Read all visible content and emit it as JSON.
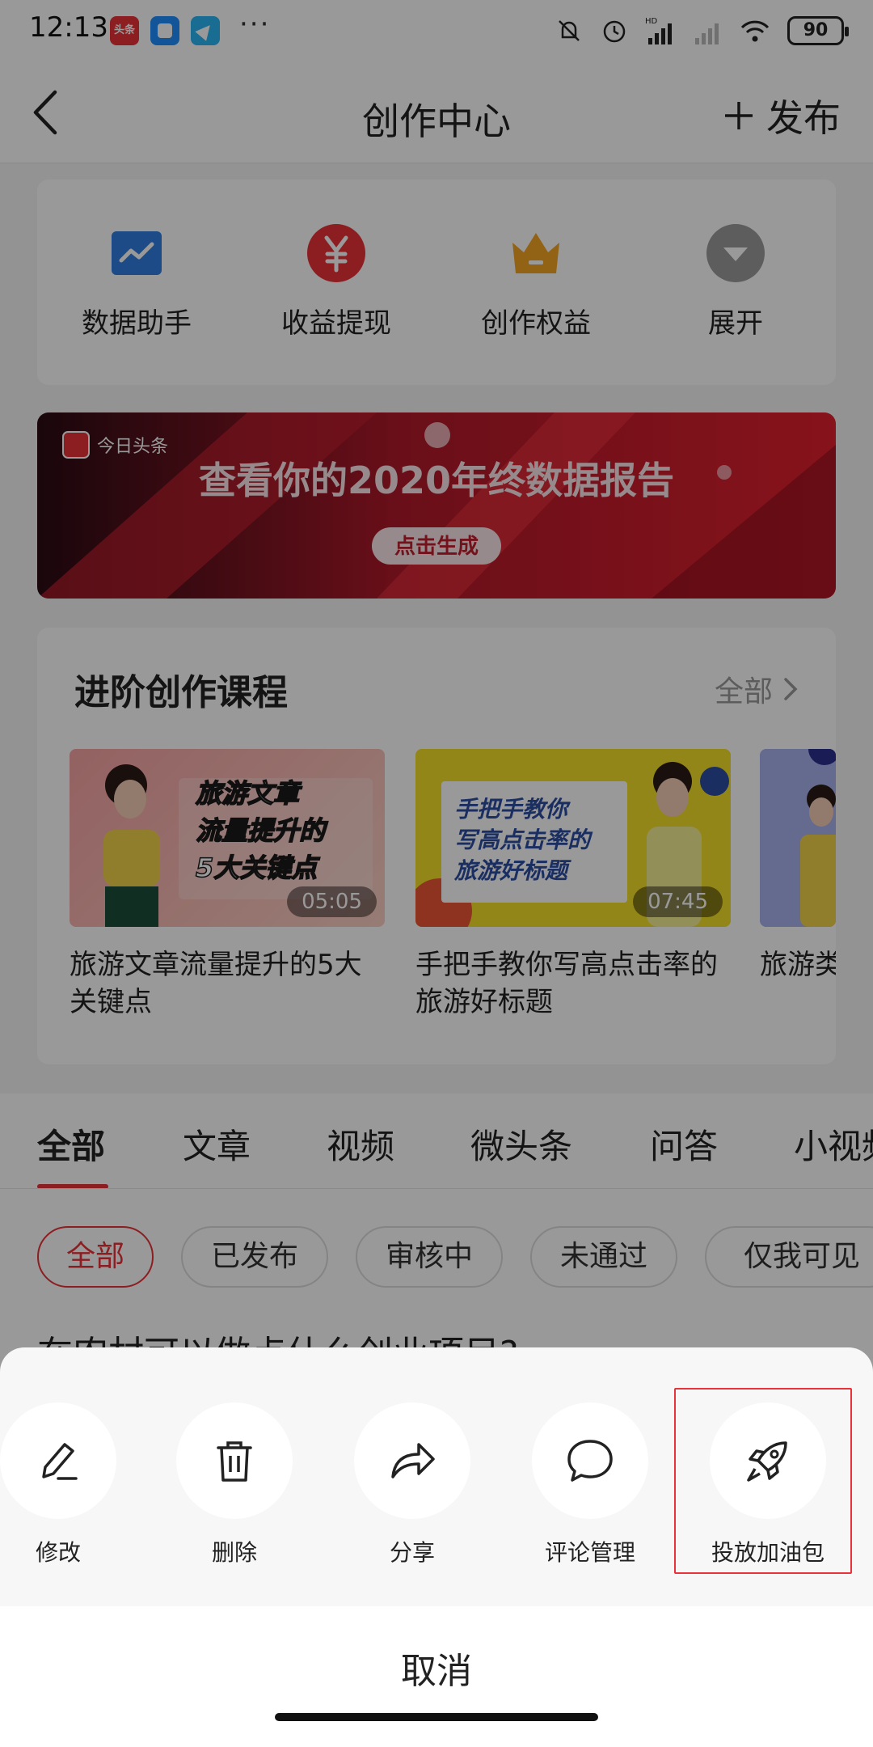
{
  "status_bar": {
    "time": "12:13",
    "badge1": "头条",
    "dots": "···",
    "battery": "90",
    "icons": [
      "mute-icon",
      "alarm-icon",
      "hd-signal-icon",
      "signal-icon",
      "wifi-icon",
      "battery-icon"
    ]
  },
  "header": {
    "title": "创作中心",
    "publish_label": "发布"
  },
  "quick_actions": [
    {
      "label": "数据助手",
      "icon": "chart-icon",
      "color": "#2f7de1"
    },
    {
      "label": "收益提现",
      "icon": "yuan-icon",
      "color": "#e9333a"
    },
    {
      "label": "创作权益",
      "icon": "crown-icon",
      "color": "#f5a623"
    },
    {
      "label": "展开",
      "icon": "expand-icon",
      "color": "#9b9b9b"
    }
  ],
  "banner": {
    "brand": "今日头条",
    "headline": "查看你的2020年终数据报告",
    "cta": "点击生成"
  },
  "courses": {
    "title": "进阶创作课程",
    "all_label": "全部",
    "items": [
      {
        "name": "旅游文章流量提升的5大关键点",
        "duration": "05:05",
        "thumb_text": "旅游文章\n流量提升的\n5大关键点"
      },
      {
        "name": "手把手教你写高点击率的旅游好标题",
        "duration": "07:45",
        "thumb_text": "手把手教你\n写高点击率的\n旅游好标题"
      },
      {
        "name": "旅游类",
        "duration": ""
      }
    ]
  },
  "tabs": [
    "全部",
    "文章",
    "视频",
    "微头条",
    "问答",
    "小视频"
  ],
  "filters": [
    "全部",
    "已发布",
    "审核中",
    "未通过",
    "仅我可见"
  ],
  "article_peek": "在农村可以做点什么创业项目?",
  "sheet": {
    "actions": [
      {
        "label": "修改",
        "icon": "pencil-icon"
      },
      {
        "label": "删除",
        "icon": "trash-icon"
      },
      {
        "label": "分享",
        "icon": "share-icon"
      },
      {
        "label": "评论管理",
        "icon": "comment-icon"
      },
      {
        "label": "投放加油包",
        "icon": "rocket-icon"
      }
    ],
    "cancel_label": "取消"
  },
  "colors": {
    "accent": "#e9333a",
    "overlay": "rgba(0,0,0,0.40)"
  }
}
